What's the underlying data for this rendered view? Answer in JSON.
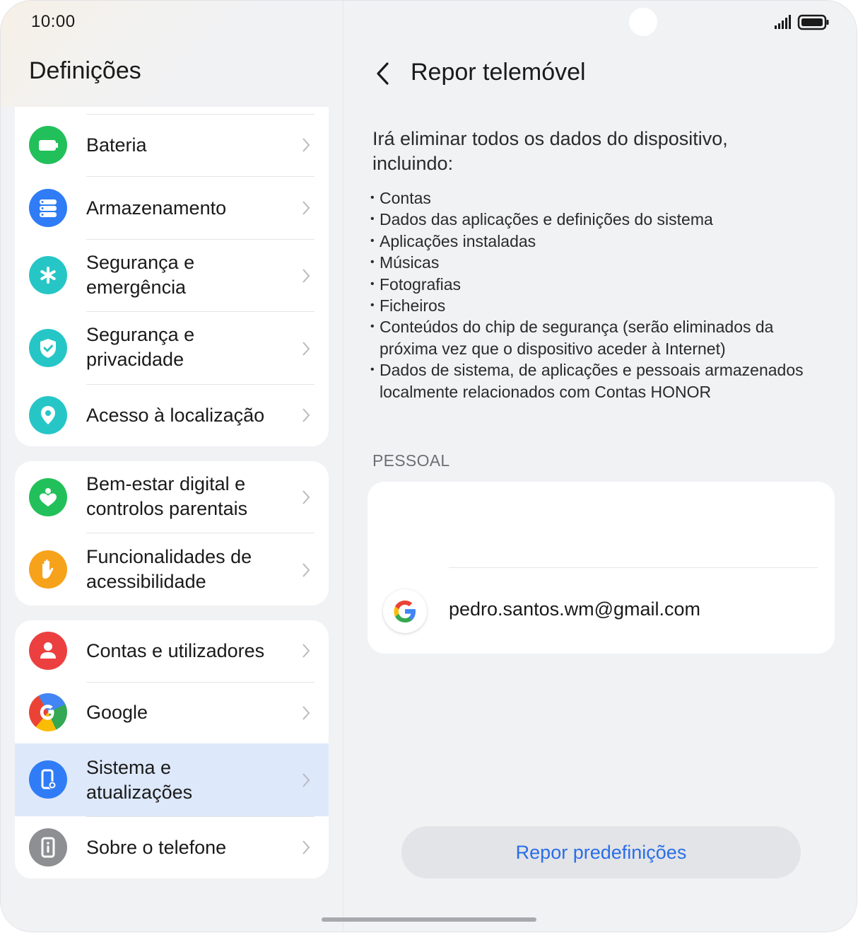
{
  "status_bar": {
    "time": "10:00"
  },
  "left": {
    "title": "Definições",
    "groups": [
      [
        {
          "label": "Bateria",
          "icon": "battery-icon",
          "color": "#22c05a"
        },
        {
          "label": "Armazenamento",
          "icon": "storage-icon",
          "color": "#2f7cf6"
        },
        {
          "label": "Segurança e\nemergência",
          "icon": "asterisk-icon",
          "color": "#27c6c6"
        },
        {
          "label": "Segurança e\nprivacidade",
          "icon": "shield-icon",
          "color": "#27c6c6"
        },
        {
          "label": "Acesso à localização",
          "icon": "location-pin-icon",
          "color": "#27c6c6"
        }
      ],
      [
        {
          "label": "Bem-estar digital e\ncontrolos parentais",
          "icon": "wellbeing-icon",
          "color": "#22c05a"
        },
        {
          "label": "Funcionalidades de\nacessibilidade",
          "icon": "hand-icon",
          "color": "#f7a21b"
        }
      ],
      [
        {
          "label": "Contas e utilizadores",
          "icon": "person-icon",
          "color": "#ec4040"
        },
        {
          "label": "Google",
          "icon": "google-icon",
          "color": "#4285f4"
        },
        {
          "label": "Sistema e\natualizações",
          "icon": "system-update-icon",
          "color": "#2f7cf6",
          "selected": true
        },
        {
          "label": "Sobre o telefone",
          "icon": "info-phone-icon",
          "color": "#8e8f93"
        }
      ]
    ]
  },
  "right": {
    "title": "Repor telemóvel",
    "intro": "Irá eliminar todos os dados do dispositivo, incluindo:",
    "bullets": [
      "Contas",
      "Dados das aplicações e definições do sistema",
      "Aplicações instaladas",
      "Músicas",
      "Fotografias",
      "Ficheiros",
      "Conteúdos do chip de segurança (serão eliminados da próxima vez que o dispositivo aceder à Internet)",
      "Dados de sistema, de aplicações e pessoais armazenados localmente relacionados com Contas HONOR"
    ],
    "section_label": "PESSOAL",
    "account_email": "pedro.santos.wm@gmail.com",
    "reset_button": "Repor predefinições"
  },
  "colors": {
    "accent": "#2a6ee8",
    "selected_row": "#dde8fb"
  }
}
